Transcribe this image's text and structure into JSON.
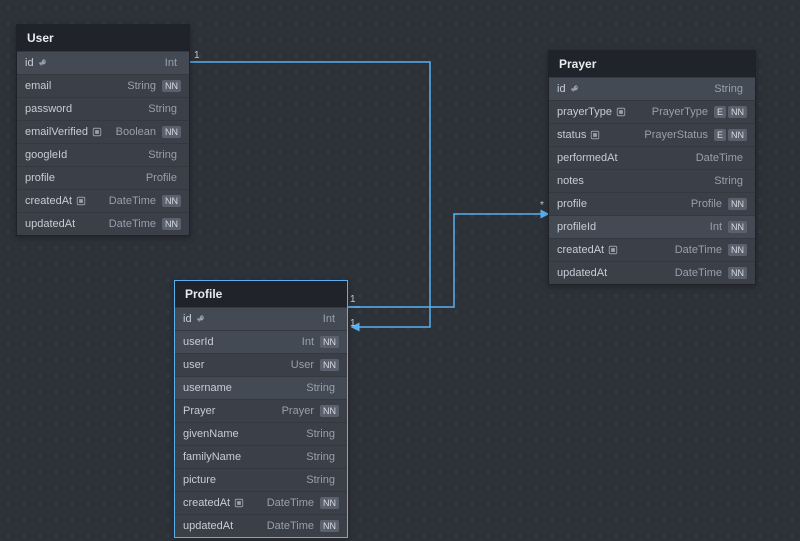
{
  "entities": {
    "user": {
      "title": "User",
      "fields": [
        {
          "name": "id",
          "type": "Int",
          "key": true,
          "hl": true
        },
        {
          "name": "email",
          "type": "String",
          "nn": true
        },
        {
          "name": "password",
          "type": "String"
        },
        {
          "name": "emailVerified",
          "type": "Boolean",
          "nn": true,
          "attr": true
        },
        {
          "name": "googleId",
          "type": "String"
        },
        {
          "name": "profile",
          "type": "Profile"
        },
        {
          "name": "createdAt",
          "type": "DateTime",
          "nn": true,
          "attr": true
        },
        {
          "name": "updatedAt",
          "type": "DateTime",
          "nn": true
        }
      ]
    },
    "profile": {
      "title": "Profile",
      "fields": [
        {
          "name": "id",
          "type": "Int",
          "key": true,
          "hl": true
        },
        {
          "name": "userId",
          "type": "Int",
          "nn": true,
          "hl": true
        },
        {
          "name": "user",
          "type": "User",
          "nn": true
        },
        {
          "name": "username",
          "type": "String",
          "hl": true
        },
        {
          "name": "Prayer",
          "type": "Prayer",
          "nn": true
        },
        {
          "name": "givenName",
          "type": "String"
        },
        {
          "name": "familyName",
          "type": "String"
        },
        {
          "name": "picture",
          "type": "String"
        },
        {
          "name": "createdAt",
          "type": "DateTime",
          "nn": true,
          "attr": true
        },
        {
          "name": "updatedAt",
          "type": "DateTime",
          "nn": true
        }
      ]
    },
    "prayer": {
      "title": "Prayer",
      "fields": [
        {
          "name": "id",
          "type": "String",
          "key": true,
          "hl": true
        },
        {
          "name": "prayerType",
          "type": "PrayerType",
          "e": true,
          "nn": true,
          "attr": true
        },
        {
          "name": "status",
          "type": "PrayerStatus",
          "e": true,
          "nn": true,
          "attr": true
        },
        {
          "name": "performedAt",
          "type": "DateTime"
        },
        {
          "name": "notes",
          "type": "String"
        },
        {
          "name": "profile",
          "type": "Profile",
          "nn": true
        },
        {
          "name": "profileId",
          "type": "Int",
          "nn": true,
          "hl": true
        },
        {
          "name": "createdAt",
          "type": "DateTime",
          "nn": true,
          "attr": true
        },
        {
          "name": "updatedAt",
          "type": "DateTime",
          "nn": true
        }
      ]
    }
  },
  "cardinalities": {
    "user_id_out": "1",
    "profile_id_out": "1",
    "profile_userId_in": "1",
    "prayer_profileId_in": "*"
  }
}
